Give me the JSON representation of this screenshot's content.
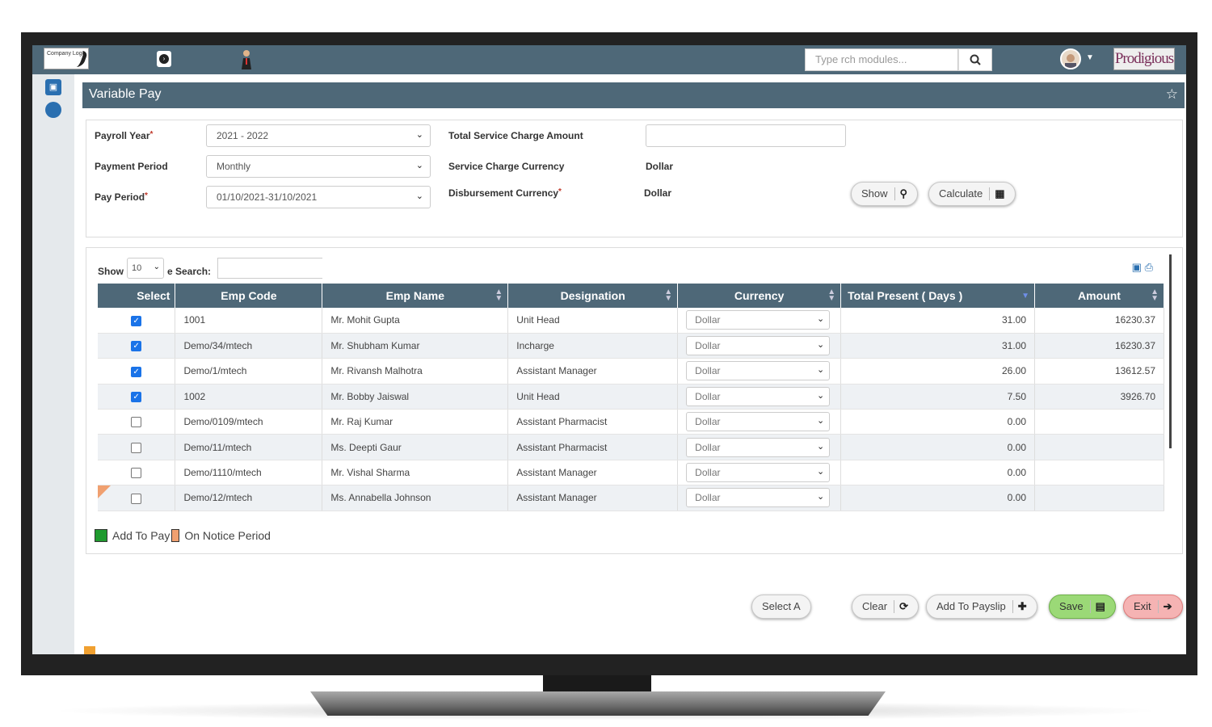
{
  "topbar": {
    "logo_text": "Company Logo",
    "search_placeholder": "Type rch modules...",
    "brand_text": "Prodigious",
    "icons": [
      "toggle-icon",
      "person-icon",
      "search-icon",
      "avatar-icon",
      "caret-down-icon"
    ]
  },
  "sidebar": {
    "icons": [
      "monitor-icon",
      "support-icon"
    ]
  },
  "page": {
    "title": "Variable Pay"
  },
  "form": {
    "payroll_year_label": "Payroll Year",
    "payroll_year_value": "2021 - 2022",
    "payment_period_label": "Payment Period",
    "payment_period_value": "Monthly",
    "pay_period_label": "Pay Period",
    "pay_period_value": "01/10/2021-31/10/2021",
    "total_service_label": "Total Service Charge Amount",
    "total_service_value": "",
    "service_currency_label": "Service Charge Currency",
    "service_currency_value": "Dollar",
    "disbursement_label": "Disbursement Currency",
    "disbursement_value": "Dollar",
    "show_button": "Show",
    "calculate_button": "Calculate"
  },
  "grid": {
    "show_label": "Show",
    "page_length": "10",
    "search_label": "e Search:",
    "columns": [
      "Select",
      "Emp Code",
      "Emp Name",
      "Designation",
      "Currency",
      "Total Present ( Days )",
      "Amount"
    ],
    "rows": [
      {
        "checked": true,
        "code": "1001",
        "name": "Mr. Mohit Gupta",
        "designation": "Unit Head",
        "currency": "Dollar",
        "days": "31.00",
        "amount": "16230.37"
      },
      {
        "checked": true,
        "code": "Demo/34/mtech",
        "name": "Mr. Shubham Kumar",
        "designation": "Incharge",
        "currency": "Dollar",
        "days": "31.00",
        "amount": "16230.37"
      },
      {
        "checked": true,
        "code": "Demo/1/mtech",
        "name": "Mr. Rivansh Malhotra",
        "designation": "Assistant Manager",
        "currency": "Dollar",
        "days": "26.00",
        "amount": "13612.57"
      },
      {
        "checked": true,
        "code": "1002",
        "name": "Mr. Bobby Jaiswal",
        "designation": "Unit Head",
        "currency": "Dollar",
        "days": "7.50",
        "amount": "3926.70"
      },
      {
        "checked": false,
        "code": "Demo/0109/mtech",
        "name": "Mr. Raj Kumar",
        "designation": "Assistant Pharmacist",
        "currency": "Dollar",
        "days": "0.00",
        "amount": ""
      },
      {
        "checked": false,
        "code": "Demo/11/mtech",
        "name": "Ms. Deepti Gaur",
        "designation": "Assistant Pharmacist",
        "currency": "Dollar",
        "days": "0.00",
        "amount": ""
      },
      {
        "checked": false,
        "code": "Demo/1110/mtech",
        "name": "Mr. Vishal Sharma",
        "designation": "Assistant Manager",
        "currency": "Dollar",
        "days": "0.00",
        "amount": ""
      },
      {
        "checked": false,
        "notice": true,
        "code": "Demo/12/mtech",
        "name": "Ms. Annabella Johnson",
        "designation": "Assistant Manager",
        "currency": "Dollar",
        "days": "0.00",
        "amount": ""
      }
    ],
    "legend_add": "Add To Pay",
    "legend_notice": "On Notice Period"
  },
  "actions": {
    "select_all": "Select A",
    "clear": "Clear",
    "add_payslip": "Add To Payslip",
    "save": "Save",
    "exit": "Exit"
  },
  "colors": {
    "header": "#4e6878",
    "accent": "#2a6fb0",
    "legend_add": "#1f9a2e",
    "legend_notice": "#f0a070",
    "save": "#9bd977",
    "exit": "#f5b3b3"
  }
}
